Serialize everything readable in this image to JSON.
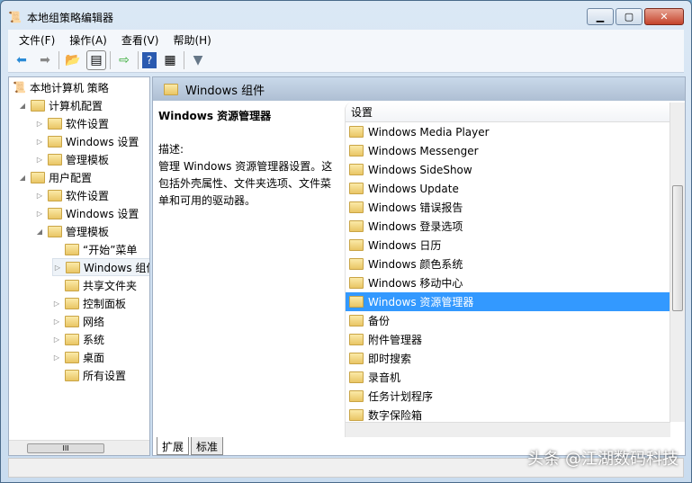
{
  "window": {
    "title": "本地组策略编辑器",
    "min": "▁",
    "max": "▢",
    "close": "✕"
  },
  "menu": [
    "文件(F)",
    "操作(A)",
    "查看(V)",
    "帮助(H)"
  ],
  "tree": {
    "root": "本地计算机 策略",
    "items": [
      {
        "label": "计算机配置",
        "level": 1,
        "exp": "◢"
      },
      {
        "label": "软件设置",
        "level": 2,
        "exp": "▷"
      },
      {
        "label": "Windows 设置",
        "level": 2,
        "exp": "▷"
      },
      {
        "label": "管理模板",
        "level": 2,
        "exp": "▷"
      },
      {
        "label": "用户配置",
        "level": 1,
        "exp": "◢"
      },
      {
        "label": "软件设置",
        "level": 2,
        "exp": "▷"
      },
      {
        "label": "Windows 设置",
        "level": 2,
        "exp": "▷"
      },
      {
        "label": "管理模板",
        "level": 2,
        "exp": "◢"
      },
      {
        "label": "“开始”菜单",
        "level": 3,
        "exp": ""
      },
      {
        "label": "Windows 组件",
        "level": 3,
        "exp": "▷"
      },
      {
        "label": "共享文件夹",
        "level": 3,
        "exp": ""
      },
      {
        "label": "控制面板",
        "level": 3,
        "exp": "▷"
      },
      {
        "label": "网络",
        "level": 3,
        "exp": "▷"
      },
      {
        "label": "系统",
        "level": 3,
        "exp": "▷"
      },
      {
        "label": "桌面",
        "level": 3,
        "exp": "▷"
      },
      {
        "label": "所有设置",
        "level": 3,
        "exp": ""
      }
    ]
  },
  "pane": {
    "header": "Windows 组件",
    "heading": "Windows 资源管理器",
    "desc_label": "描述:",
    "desc": "管理 Windows 资源管理器设置。这包括外壳属性、文件夹选项、文件菜单和可用的驱动器。"
  },
  "list": {
    "column": "设置",
    "items": [
      "Windows Media Player",
      "Windows Messenger",
      "Windows SideShow",
      "Windows Update",
      "Windows 错误报告",
      "Windows 登录选项",
      "Windows 日历",
      "Windows 颜色系统",
      "Windows 移动中心",
      "Windows 资源管理器",
      "备份",
      "附件管理器",
      "即时搜索",
      "录音机",
      "任务计划程序",
      "数字保险箱"
    ],
    "selected": 9
  },
  "tabs": [
    "扩展",
    "标准"
  ],
  "watermark": "头条 @江湖数码科技"
}
